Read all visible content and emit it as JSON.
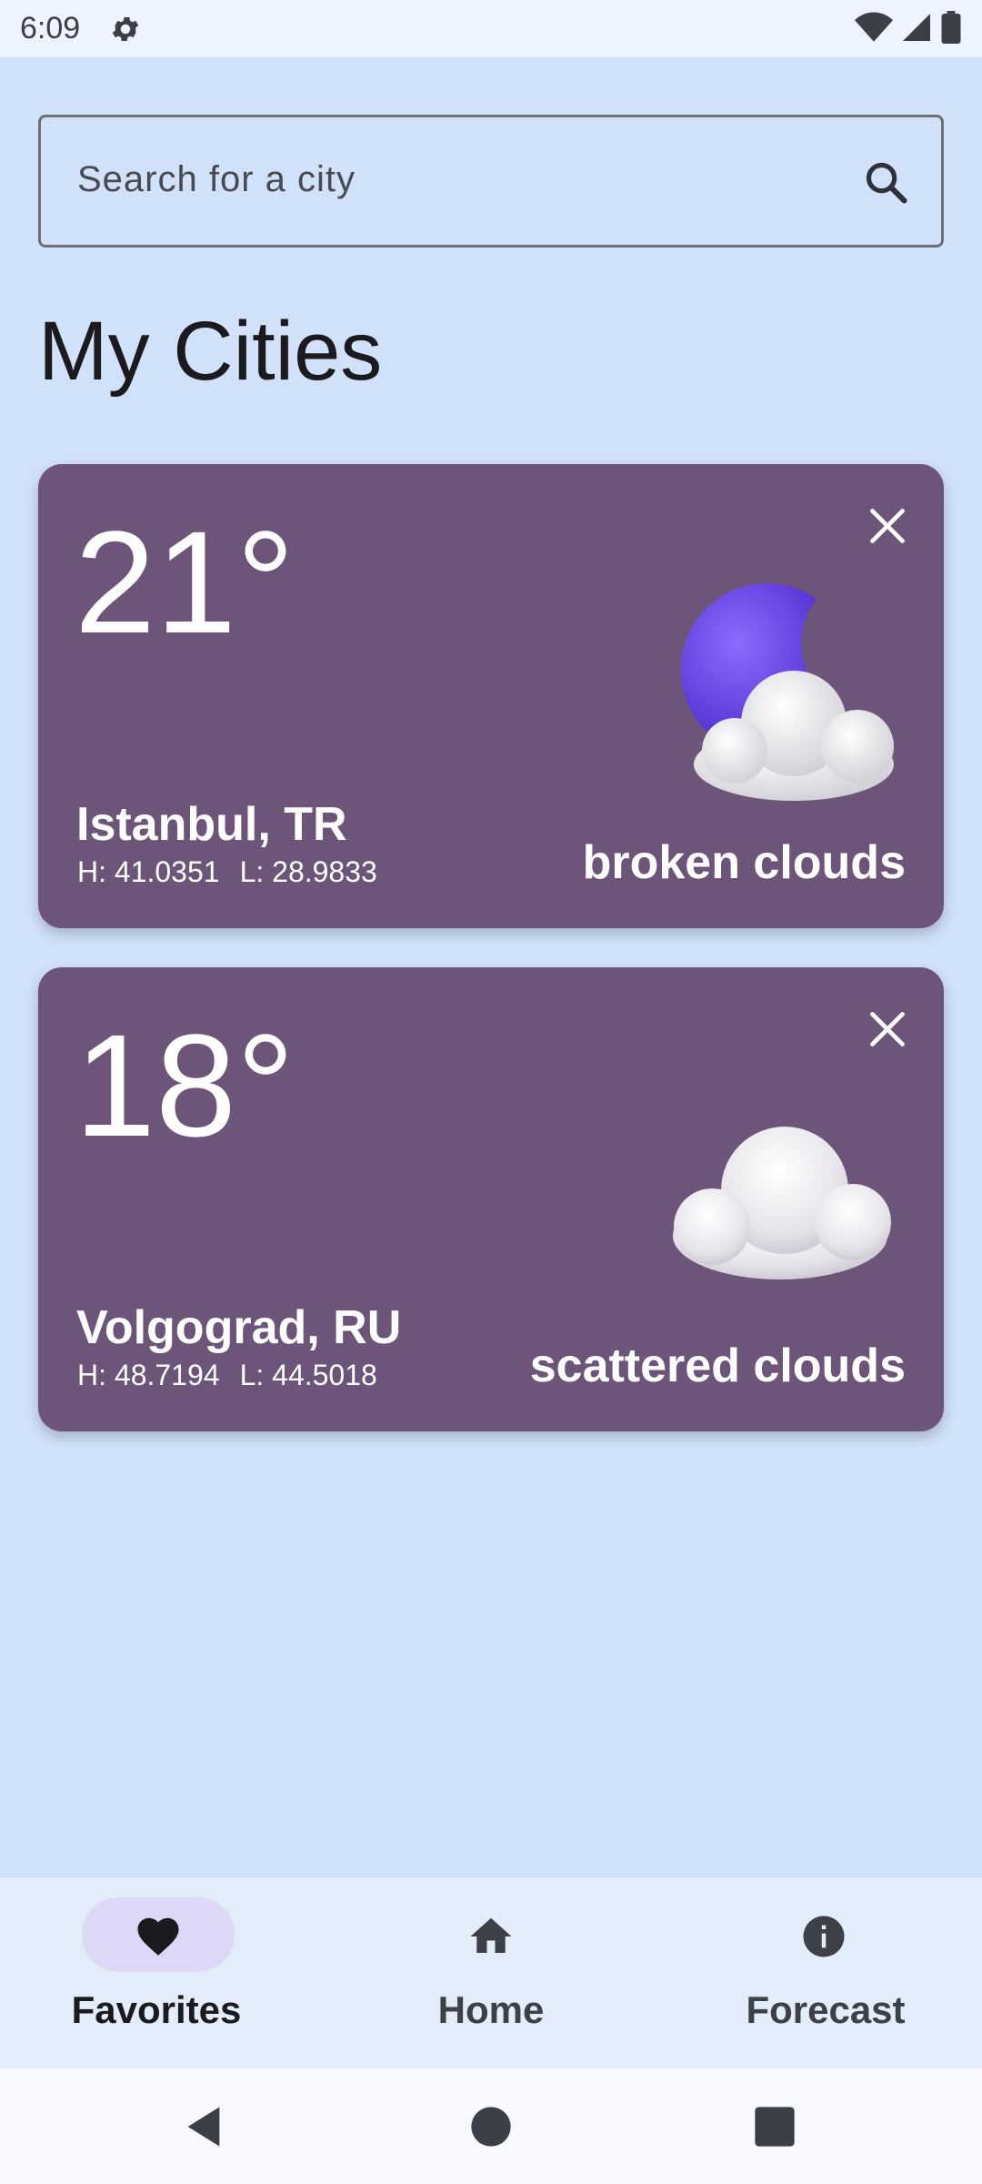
{
  "status_bar": {
    "time": "6:09"
  },
  "search": {
    "placeholder": "Search for a city"
  },
  "page": {
    "title": "My Cities"
  },
  "cities": [
    {
      "temp": "21°",
      "city": "Istanbul, TR",
      "lat": "H: 41.0351",
      "lon": "L: 28.9833",
      "condition": "broken clouds",
      "icon": "moon-cloud-icon"
    },
    {
      "temp": "18°",
      "city": "Volgograd, RU",
      "lat": "H: 48.7194",
      "lon": "L: 44.5018",
      "condition": "scattered clouds",
      "icon": "cloud-icon"
    }
  ],
  "nav": {
    "items": [
      {
        "label": "Favorites",
        "icon": "heart-icon",
        "selected": true
      },
      {
        "label": "Home",
        "icon": "home-icon",
        "selected": false
      },
      {
        "label": "Forecast",
        "icon": "info-icon",
        "selected": false
      }
    ]
  },
  "colors": {
    "background": "#d2e1fa",
    "card": "#6d5579",
    "nav_bar": "#e3ecf9",
    "nav_selected_pill": "#ddd8f6"
  }
}
